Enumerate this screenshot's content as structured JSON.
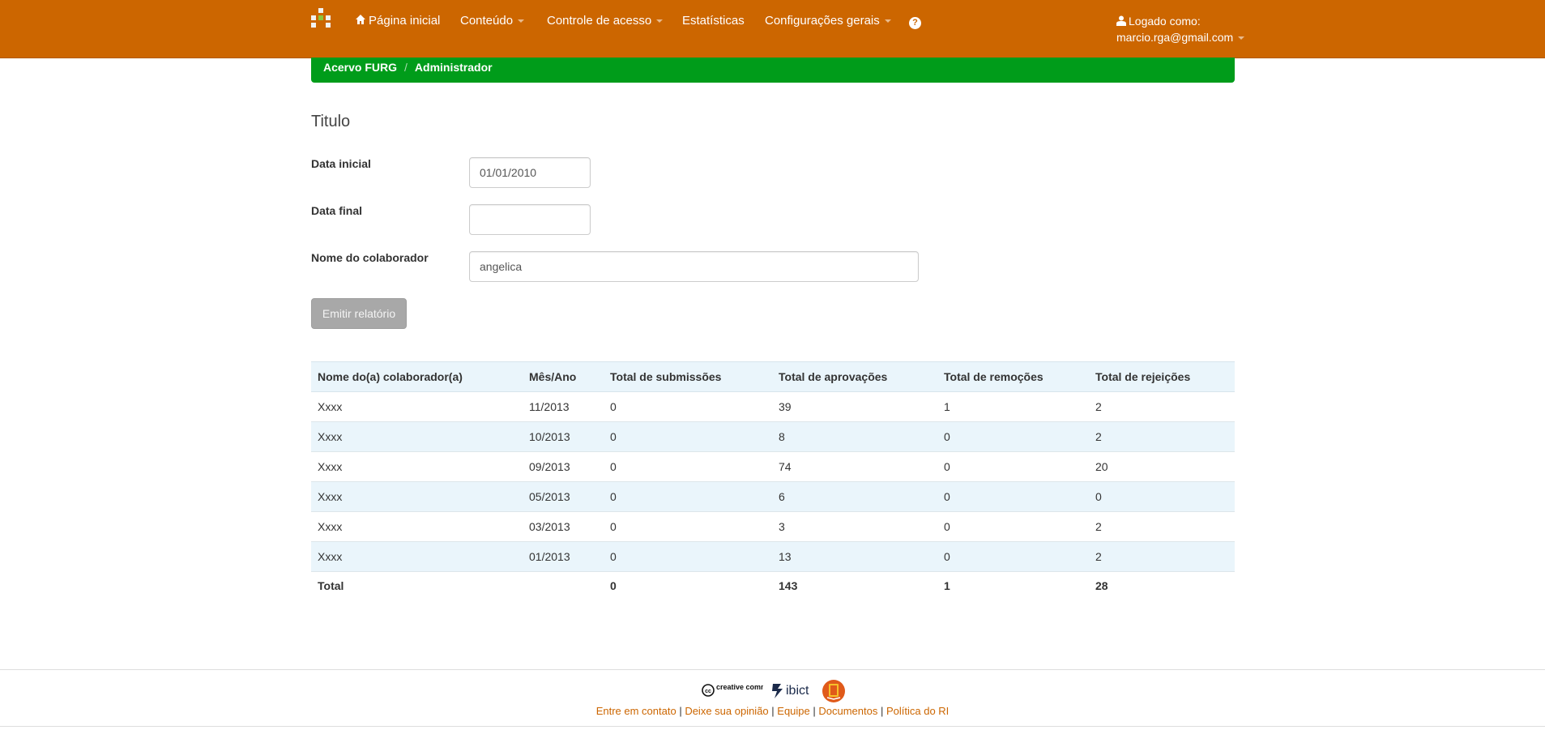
{
  "navbar": {
    "home": "Página inicial",
    "content": "Conteúdo",
    "access": "Controle de acesso",
    "stats": "Estatísticas",
    "settings": "Configurações gerais",
    "help": "?",
    "user_label": "Logado como:",
    "user_email": "marcio.rga@gmail.com"
  },
  "breadcrumb": {
    "item1": "Acervo FURG",
    "separator": "/",
    "item2": "Administrador"
  },
  "form": {
    "title": "Titulo",
    "start_label": "Data inicial",
    "start_value": "01/01/2010",
    "end_label": "Data final",
    "end_value": "",
    "name_label": "Nome do colaborador",
    "name_value": "angelica",
    "submit_label": "Emitir relatório"
  },
  "table": {
    "headers": [
      "Nome do(a) colaborador(a)",
      "Mês/Ano",
      "Total de submissões",
      "Total de aprovações",
      "Total de remoções",
      "Total de rejeições"
    ],
    "rows": [
      [
        "Xxxx",
        "11/2013",
        "0",
        "39",
        "1",
        "2"
      ],
      [
        "Xxxx",
        "10/2013",
        "0",
        "8",
        "0",
        "2"
      ],
      [
        "Xxxx",
        "09/2013",
        "0",
        "74",
        "0",
        "20"
      ],
      [
        "Xxxx",
        "05/2013",
        "0",
        "6",
        "0",
        "0"
      ],
      [
        "Xxxx",
        "03/2013",
        "0",
        "3",
        "0",
        "2"
      ],
      [
        "Xxxx",
        "01/2013",
        "0",
        "13",
        "0",
        "2"
      ]
    ],
    "total": [
      "Total",
      "",
      "0",
      "143",
      "1",
      "28"
    ]
  },
  "footer": {
    "cc_text": "creative commons",
    "ibict_text": "ibict",
    "links": [
      "Entre em contato",
      "Deixe sua opinião",
      "Equipe",
      "Documentos",
      "Política do RI"
    ],
    "separator": " | "
  },
  "colors": {
    "navbar": "#cc6600",
    "breadcrumb": "#009c1a",
    "link": "#cc6600",
    "table_stripe": "#eaf5fb"
  }
}
